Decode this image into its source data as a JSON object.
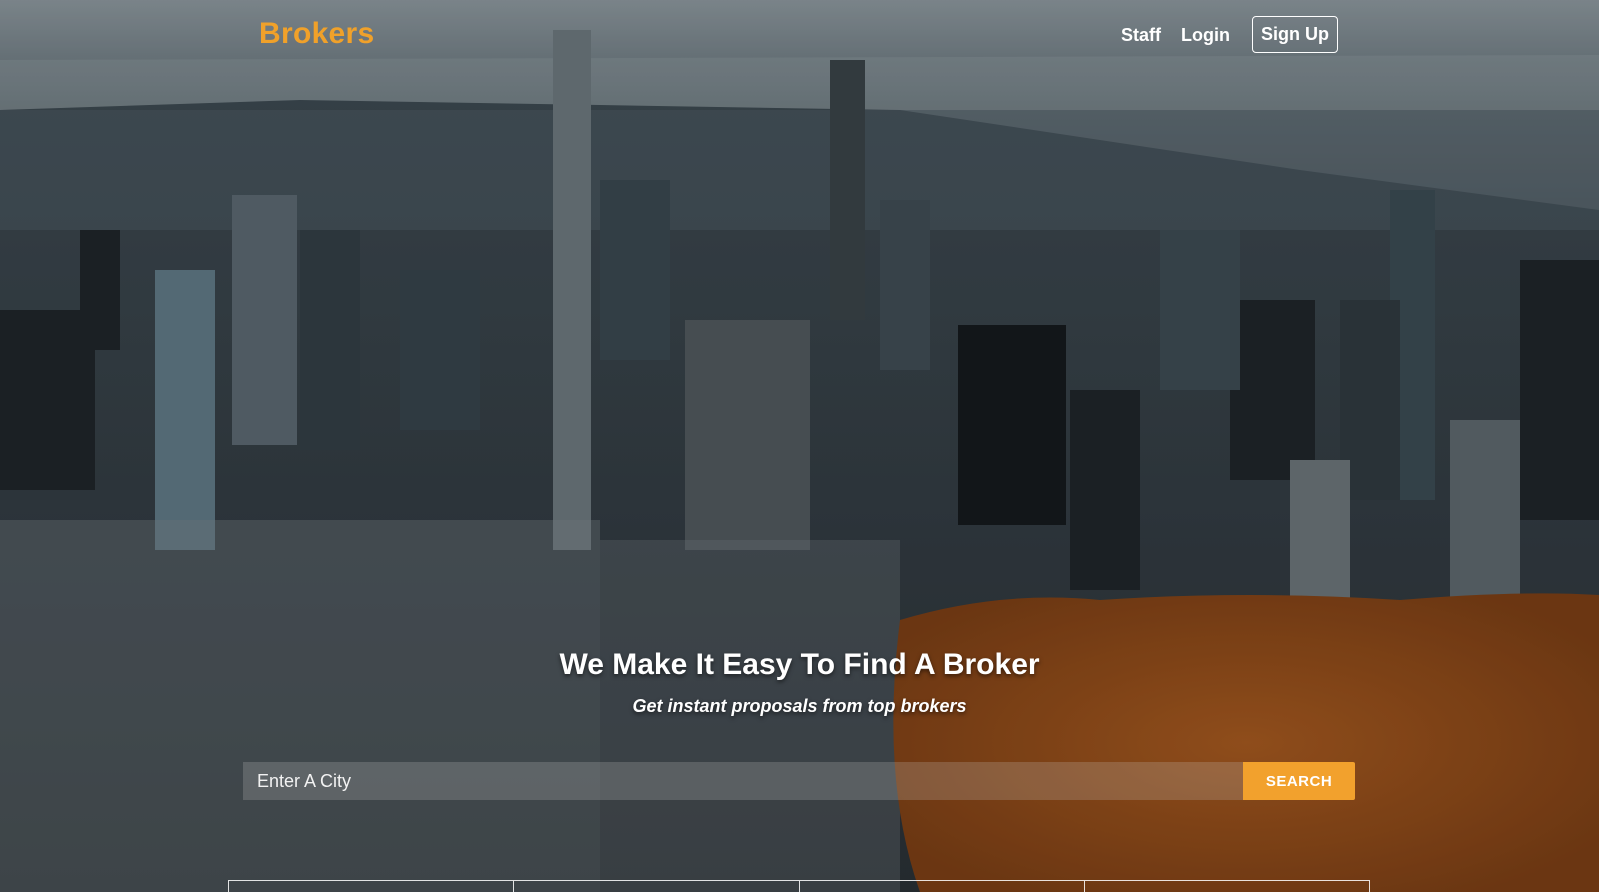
{
  "nav": {
    "brand": "Brokers",
    "links": [
      "Staff",
      "Login"
    ],
    "signup_label": "Sign Up"
  },
  "hero": {
    "title": "We Make It Easy To Find A Broker",
    "subtitle": "Get instant proposals from top brokers"
  },
  "search": {
    "placeholder": "Enter A City",
    "value": "",
    "button_label": "SEARCH"
  },
  "colors": {
    "accent": "#f2a12d",
    "brand": "#f0a12a"
  }
}
